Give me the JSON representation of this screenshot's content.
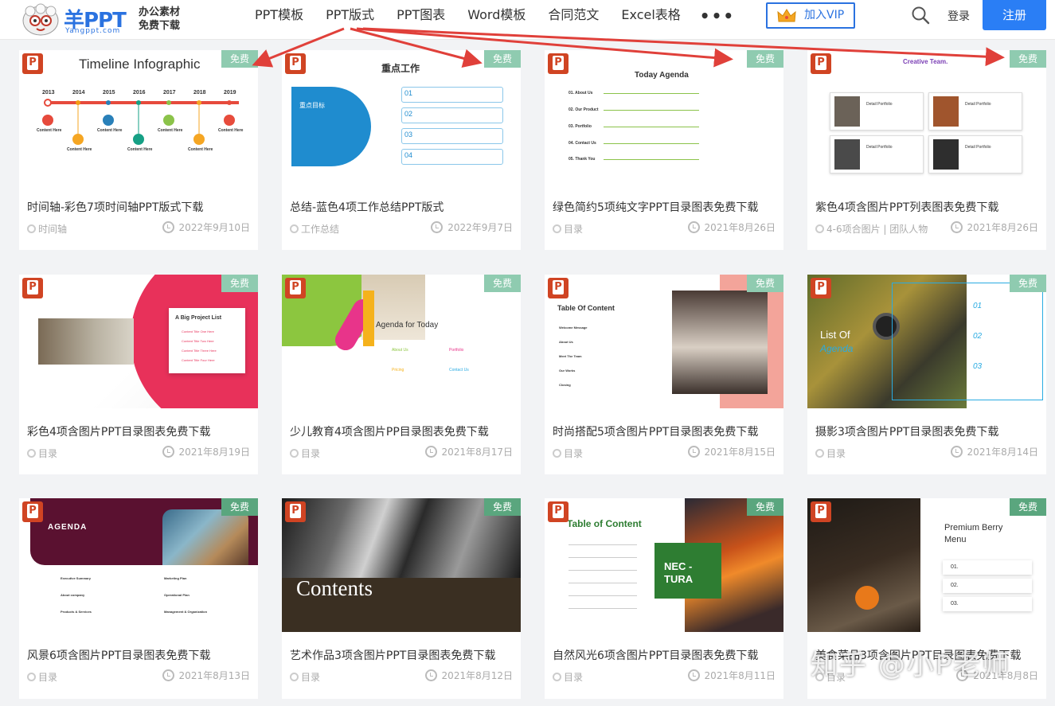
{
  "header": {
    "brand": "羊PPT",
    "brand_sub": "Yangppt.com",
    "slogan_line1": "办公素材",
    "slogan_line2": "免费下载",
    "nav": [
      "PPT模板",
      "PPT版式",
      "PPT图表",
      "Word模板",
      "合同范文",
      "Excel表格"
    ],
    "more": "•••",
    "vip": "加入VIP",
    "login": "登录",
    "register": "注册"
  },
  "free_label": "免费",
  "cards": [
    {
      "title": "时间轴-彩色7项时间轴PPT版式下载",
      "tag": "时间轴",
      "date": "2022年9月10日",
      "thumb_title": "Timeline Infographic",
      "years": [
        "2013",
        "2014",
        "2015",
        "2016",
        "2017",
        "2018",
        "2019"
      ],
      "content_label": "Content Here"
    },
    {
      "title": "总结-蓝色4项工作总结PPT版式",
      "tag": "工作总结",
      "date": "2022年9月7日",
      "thumb_title": "重点工作",
      "thumb_sub": "重点目标",
      "nums": [
        "01",
        "02",
        "03",
        "04"
      ]
    },
    {
      "title": "绿色简约5项纯文字PPT目录图表免费下载",
      "tag": "目录",
      "date": "2021年8月26日",
      "thumb_title": "Today Agenda",
      "items": [
        "01. About Us",
        "02. Our Product",
        "03. Portfolio",
        "04. Contact Us",
        "05. Thank You"
      ]
    },
    {
      "title": "紫色4项含图片PPT列表图表免费下载",
      "tag": "4-6项合图片 | 团队人物",
      "date": "2021年8月26日",
      "thumb_title": "Creative Team.",
      "label": "Detail Portfolio"
    },
    {
      "title": "彩色4项含图片PPT目录图表免费下载",
      "tag": "目录",
      "date": "2021年8月19日",
      "thumb_title": "A Big Project List",
      "items": [
        "Content Title One Here",
        "Content Title Two Here",
        "Content Title Three Here",
        "Content Title Four Here"
      ]
    },
    {
      "title": "少儿教育4项含图片PP目录图表免费下载",
      "tag": "目录",
      "date": "2021年8月17日",
      "thumb_title": "Agenda for Today",
      "items": [
        "About Us",
        "Portfolio",
        "Pricing",
        "Contact Us"
      ]
    },
    {
      "title": "时尚搭配5项含图片PPT目录图表免费下载",
      "tag": "目录",
      "date": "2021年8月15日",
      "thumb_title": "Table Of Content",
      "items": [
        "Welcome Message",
        "About Us",
        "Meet The Team",
        "Our Works",
        "Closing"
      ]
    },
    {
      "title": "摄影3项含图片PPT目录图表免费下载",
      "tag": "目录",
      "date": "2021年8月14日",
      "thumb_title": "List Of",
      "thumb_sub": "Agenda",
      "nums": [
        "01",
        "02",
        "03"
      ]
    },
    {
      "title": "风景6项含图片PPT目录图表免费下载",
      "tag": "目录",
      "date": "2021年8月13日",
      "thumb_title": "AGENDA",
      "items": [
        "Executive Summary",
        "About company",
        "Products & Services",
        "Marketing Plan",
        "Operational Plan",
        "Management & Organization"
      ]
    },
    {
      "title": "艺术作品3项含图片PPT目录图表免费下载",
      "tag": "目录",
      "date": "2021年8月12日",
      "thumb_title": "Contents"
    },
    {
      "title": "自然风光6项含图片PPT目录图表免费下载",
      "tag": "目录",
      "date": "2021年8月11日",
      "thumb_title": "Table of Content",
      "thumb_sub": "NEC - TURA"
    },
    {
      "title": "美食菜品3项含图片PPT目录图表免费下载",
      "tag": "目录",
      "date": "2021年8月8日",
      "thumb_title": "Premium Berry",
      "thumb_sub": "Menu",
      "items": [
        "01.",
        "02.",
        "03."
      ]
    }
  ],
  "watermark": "知乎 @小P老师",
  "colors": {
    "accent": "#2a72e0",
    "free_badge": "#8fcbb0",
    "arrow": "#e0403a"
  }
}
